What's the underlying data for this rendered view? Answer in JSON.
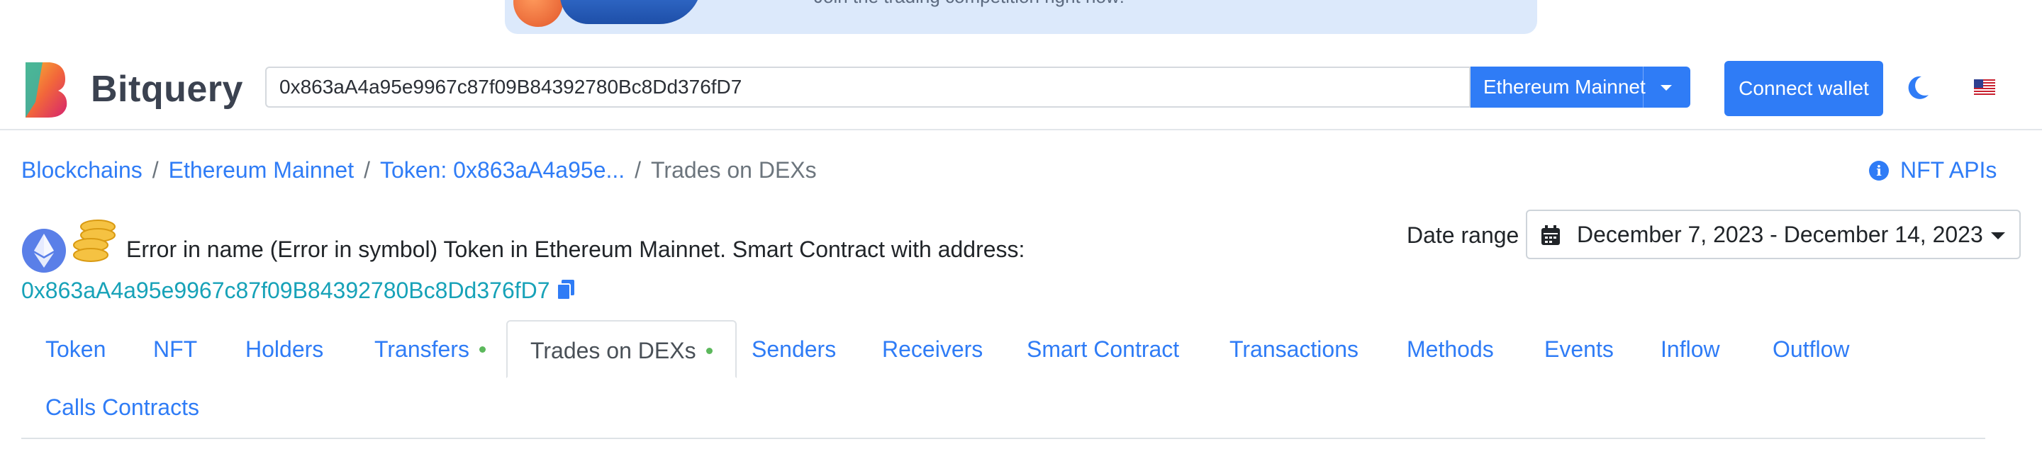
{
  "banner": {
    "text": "Join the trading competition right now!"
  },
  "header": {
    "brand": "Bitquery",
    "search_value": "0x863aA4a95e9967c87f09B84392780Bc8Dd376fD7",
    "network": "Ethereum Mainnet",
    "connect_label": "Connect wallet",
    "flag": "🇺🇸"
  },
  "breadcrumb": {
    "items": [
      "Blockchains",
      "Ethereum Mainnet",
      "Token: 0x863aA4a95e...",
      "Trades on DEXs"
    ],
    "separator": "/"
  },
  "nft_apis": {
    "label": "NFT APIs",
    "info": "i"
  },
  "token": {
    "description": "Error in name (Error in symbol) Token in Ethereum Mainnet. Smart Contract with address:",
    "address": "0x863aA4a95e9967c87f09B84392780Bc8Dd376fD7"
  },
  "date_range": {
    "label": "Date range",
    "value": "December 7, 2023 - December 14, 2023"
  },
  "tabs": [
    {
      "label": "Token"
    },
    {
      "label": "NFT"
    },
    {
      "label": "Holders"
    },
    {
      "label": "Transfers"
    },
    {
      "label": "Trades on DEXs"
    },
    {
      "label": "Senders"
    },
    {
      "label": "Receivers"
    },
    {
      "label": "Smart Contract"
    },
    {
      "label": "Transactions"
    },
    {
      "label": "Methods"
    },
    {
      "label": "Events"
    },
    {
      "label": "Inflow"
    },
    {
      "label": "Outflow"
    },
    {
      "label": "Calls Contracts"
    }
  ],
  "colors": {
    "accent": "#2f7cf6",
    "address": "#17a2b8",
    "indicator": "#5cb85c"
  },
  "icons": [
    "bitquery-logo-icon",
    "moon-icon",
    "us-flag-icon",
    "info-icon",
    "ethereum-icon",
    "coins-icon",
    "copy-icon",
    "calendar-icon",
    "chevron-down-icon"
  ]
}
